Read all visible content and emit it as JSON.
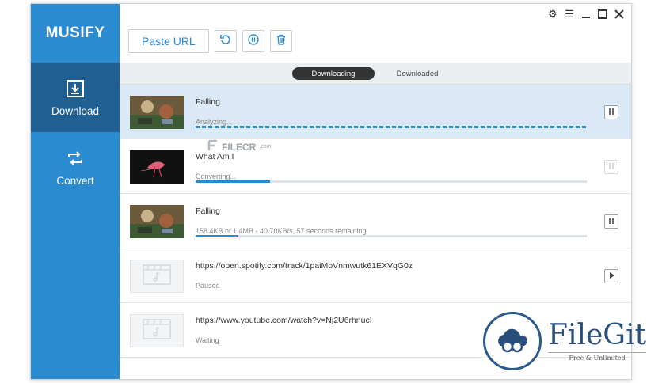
{
  "app": {
    "name": "MUSIFY"
  },
  "sidebar": {
    "items": [
      {
        "label": "Download",
        "icon": "download-icon",
        "active": true
      },
      {
        "label": "Convert",
        "icon": "convert-icon",
        "active": false
      }
    ]
  },
  "toolbar": {
    "paste_label": "Paste URL",
    "buttons": [
      "refresh-icon",
      "pause-all-icon",
      "trash-icon"
    ]
  },
  "window_controls": [
    "gear-icon",
    "menu-icon",
    "minimize-icon",
    "maximize-icon",
    "close-icon"
  ],
  "tabs": [
    {
      "label": "Downloading",
      "active": true
    },
    {
      "label": "Downloaded",
      "active": false
    }
  ],
  "downloads": [
    {
      "title": "Falling",
      "status": "Analyzing...",
      "progress": null,
      "action": "pause-icon",
      "selected": true,
      "thumb": "photo"
    },
    {
      "title": "What Am I",
      "status": "Converting...",
      "progress": 0.19,
      "action": "pause-icon",
      "disabled": true,
      "thumb": "dark"
    },
    {
      "title": "Falling",
      "status": "158.4KB of 1.4MB - 40.70KB/s, 57 seconds remaining",
      "progress": 0.11,
      "action": "pause-icon",
      "thumb": "photo"
    },
    {
      "title": "https://open.spotify.com/track/1paiMpVnmwutk61EXVqG0z",
      "status": "Paused",
      "progress": null,
      "action": "play-icon",
      "thumb": "placeholder"
    },
    {
      "title": "https://www.youtube.com/watch?v=Nj2U6rhnucI",
      "status": "Waiting",
      "progress": null,
      "action": "play-icon",
      "thumb": "placeholder"
    }
  ],
  "watermark": {
    "text": "FILECR",
    "suffix": ".com"
  },
  "overlay_logo": {
    "name": "FileGit",
    "tagline": "Free & Unlimited"
  },
  "colors": {
    "accent": "#2a8bd0",
    "sidebar_active": "#1f5f92",
    "selected_row": "#dbe9f6"
  }
}
